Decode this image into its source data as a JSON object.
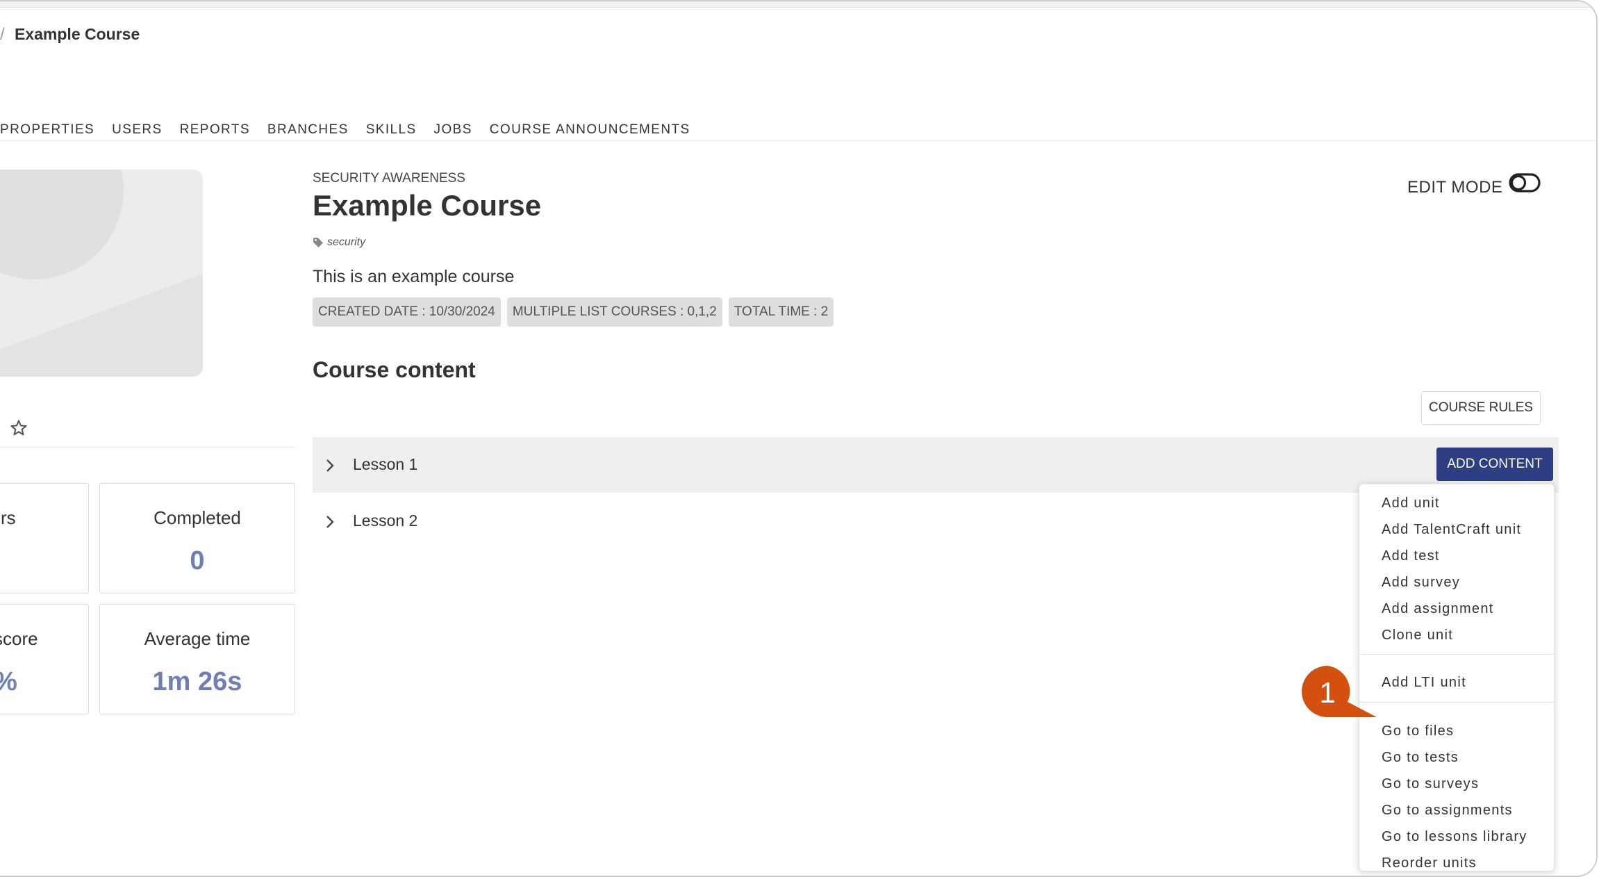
{
  "breadcrumb": {
    "separator": "/",
    "title": "Example Course"
  },
  "tabs": [
    "PROPERTIES",
    "USERS",
    "REPORTS",
    "BRANCHES",
    "SKILLS",
    "JOBS",
    "COURSE ANNOUNCEMENTS"
  ],
  "course": {
    "category": "SECURITY AWARENESS",
    "title": "Example Course",
    "tag": "security",
    "description": "This is an example course",
    "badges": [
      "CREATED DATE : 10/30/2024",
      "MULTIPLE LIST COURSES : 0,1,2",
      "TOTAL TIME : 2"
    ]
  },
  "edit_mode": {
    "label": "EDIT MODE",
    "enabled": false
  },
  "stats": [
    {
      "label": "rs",
      "value": ""
    },
    {
      "label": "Completed",
      "value": "0"
    },
    {
      "label": "score",
      "value": "%"
    },
    {
      "label": "Average time",
      "value": "1m 26s"
    }
  ],
  "content": {
    "title": "Course content",
    "rules_button": "COURSE RULES",
    "add_button": "ADD CONTENT",
    "lessons": [
      {
        "name": "Lesson 1"
      },
      {
        "name": "Lesson 2"
      }
    ]
  },
  "menu": {
    "group1": [
      "Add unit",
      "Add TalentCraft unit",
      "Add test",
      "Add survey",
      "Add assignment",
      "Clone unit"
    ],
    "group2": [
      "Add LTI unit"
    ],
    "group3": [
      "Go to files",
      "Go to tests",
      "Go to surveys",
      "Go to assignments",
      "Go to lessons library",
      "Reorder units"
    ]
  },
  "callout": {
    "number": "1"
  },
  "colors": {
    "primary": "#2d3f82",
    "stat_value": "#6f7eb5",
    "callout": "#d4500f",
    "row_active": "#eeeff1"
  },
  "icons": {
    "tag": "tag-icon",
    "star": "star-icon",
    "chevron": "chevron-right-icon",
    "toggle": "toggle-icon"
  }
}
